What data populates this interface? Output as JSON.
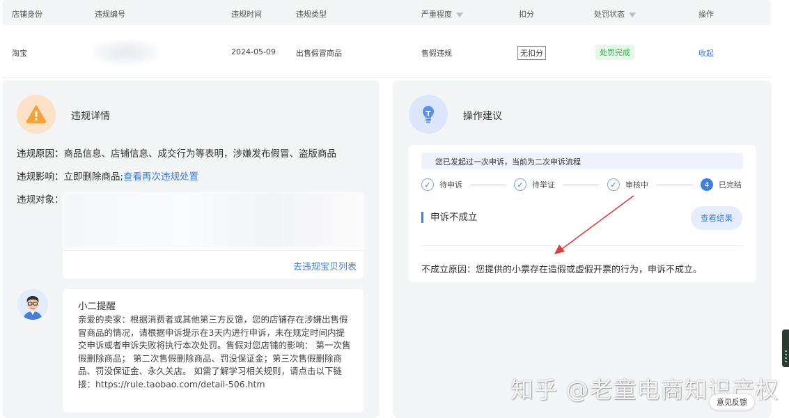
{
  "table": {
    "headers": {
      "shop_identity": "店铺身份",
      "violation_id": "违规编号",
      "violation_time": "违规时间",
      "violation_type": "违规类型",
      "severity": "严重程度",
      "deduction": "扣分",
      "penalty_status": "处罚状态",
      "actions": "操作"
    },
    "row": {
      "shop_identity": "淘宝",
      "violation_time": "2024-05-09",
      "violation_type": "出售假冒商品",
      "severity": "售假违规",
      "deduction": "无扣分",
      "penalty_status": "处罚完成",
      "action": "收起"
    }
  },
  "details": {
    "title": "违规详情",
    "reason_label": "违规原因：",
    "reason_text": "商品信息、店铺信息、成交行为等表明，涉嫌发布假冒、盗版商品",
    "impact_label": "违规影响：",
    "impact_text": "立即删除商品;",
    "impact_link": "查看再次违规处置",
    "object_label": "违规对象：",
    "object_link": "去违规宝贝列表",
    "notice_title": "小二提醒",
    "notice_body": "亲爱的卖家：根据消费者或其他第三方反馈，您的店铺存在涉嫌出售假冒商品的情况，请根据申诉提示在3天内进行申诉，未在规定时间内提交申诉或者申诉失败将执行本次处罚。售假对您店铺的影响： 第一次售假删除商品； 第二次售假删除商品、罚没保证金；第三次售假删除商品、罚没保证金、永久关店。 如需了解学习相关规则，请点击以下链接：https://rule.taobao.com/detail-506.htm"
  },
  "suggestion": {
    "title": "操作建议",
    "banner": "您已发起过一次申诉，当前为二次申诉流程",
    "steps": [
      {
        "label": "待申诉"
      },
      {
        "label": "待举证"
      },
      {
        "label": "审核中"
      },
      {
        "label": "已完结",
        "number": "4"
      }
    ],
    "result_title": "申诉不成立",
    "result_button": "查看结果",
    "fail_reason": "不成立原因：您提供的小票存在造假或虚假开票的行为，申诉不成立。"
  },
  "overlay": {
    "watermark": "知乎 @老童电商知识产权",
    "feedback": "意见反馈"
  },
  "colors": {
    "accent": "#3d7ee8",
    "success": "#2db64d",
    "warning": "#f7a33a",
    "annotation_arrow": "#e23b3b"
  }
}
